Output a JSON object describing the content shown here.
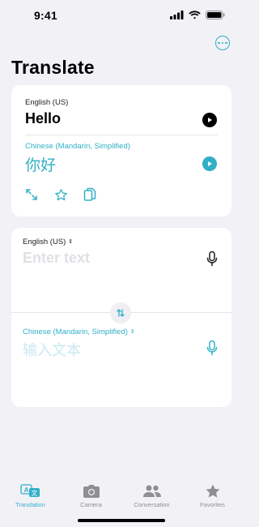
{
  "status_bar": {
    "time": "9:41"
  },
  "header": {
    "title": "Translate",
    "more_icon": "ellipsis-circle-icon"
  },
  "result_card": {
    "source_language": "English (US)",
    "source_text": "Hello",
    "target_language": "Chinese (Mandarin, Simplified)",
    "target_text": "你好",
    "actions": [
      "expand-icon",
      "star-icon",
      "copy-icon"
    ]
  },
  "input_card": {
    "source_language": "English (US)",
    "source_placeholder": "Enter text",
    "target_language": "Chinese (Mandarin, Simplified)",
    "target_placeholder": "输入文本"
  },
  "tabs": [
    {
      "label": "Translation",
      "icon": "translate-icon",
      "active": true
    },
    {
      "label": "Camera",
      "icon": "camera-icon",
      "active": false
    },
    {
      "label": "Conversation",
      "icon": "people-icon",
      "active": false
    },
    {
      "label": "Favorites",
      "icon": "star-icon",
      "active": false
    }
  ],
  "colors": {
    "accent": "#30b0c7",
    "background": "#f2f1f6",
    "card": "#ffffff"
  }
}
